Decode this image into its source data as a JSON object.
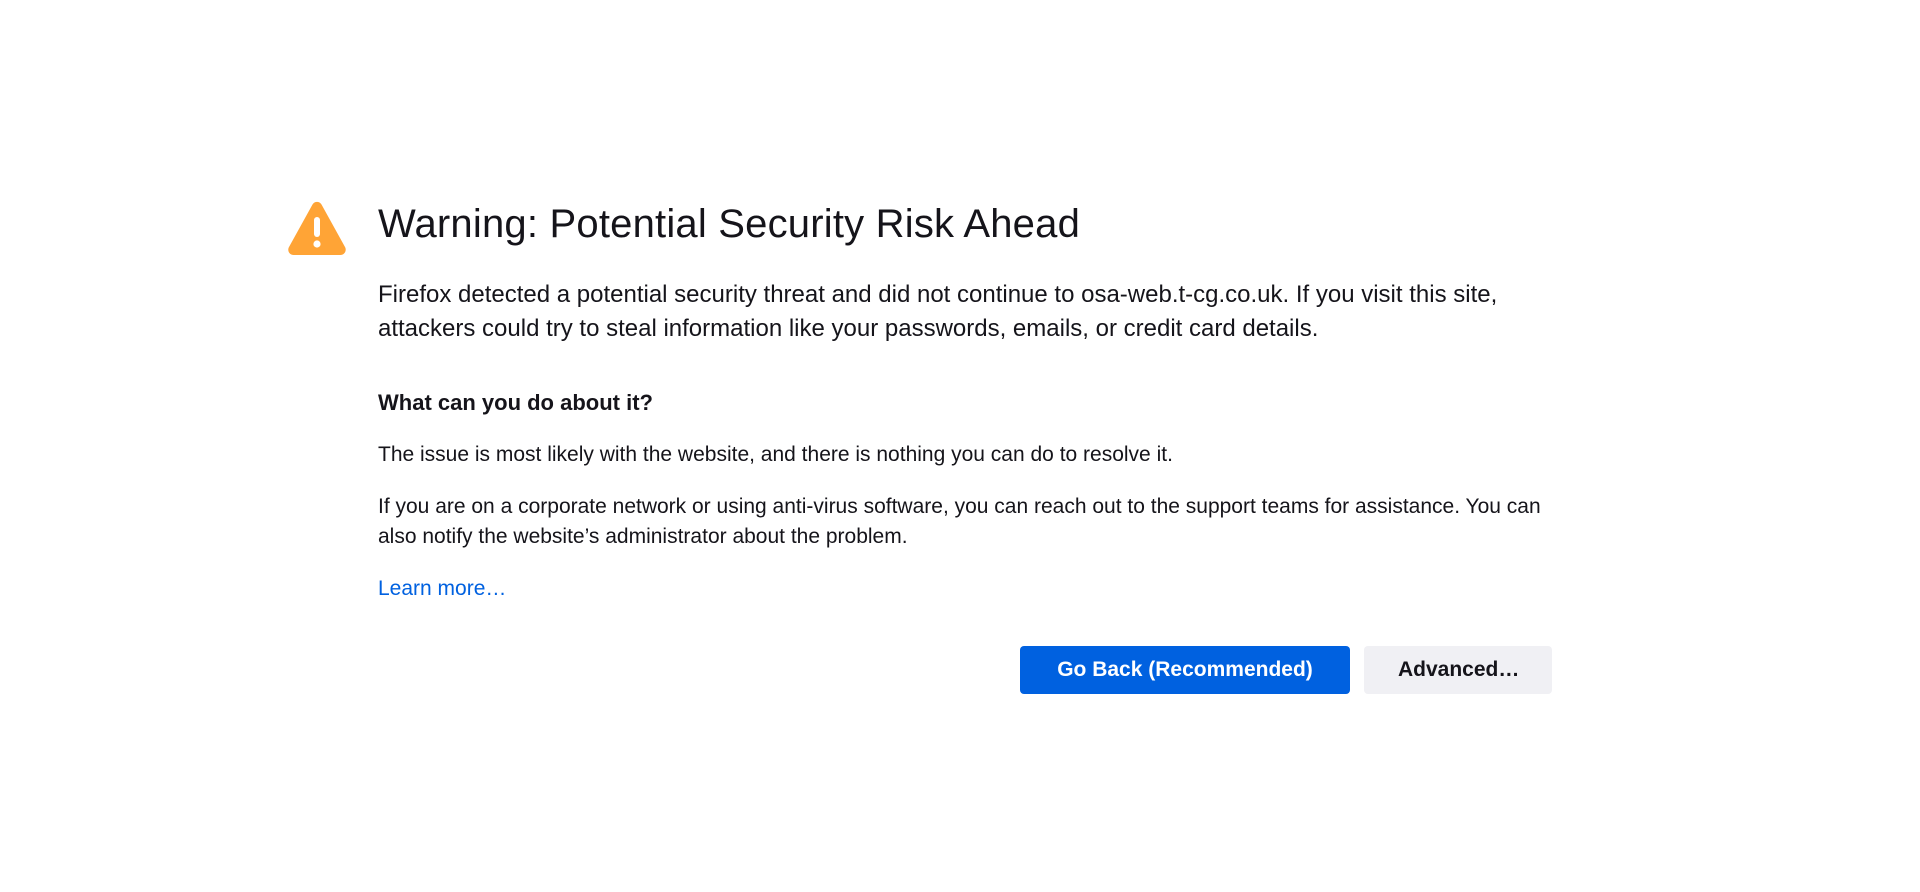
{
  "header": {
    "title": "Warning: Potential Security Risk Ahead"
  },
  "main": {
    "intro": "Firefox detected a potential security threat and did not continue to osa-web.t-cg.co.uk. If you visit this site, attackers could try to steal information like your passwords, emails, or credit card details.",
    "subheading": "What can you do about it?",
    "paragraphs": [
      "The issue is most likely with the website, and there is nothing you can do to resolve it.",
      "If you are on a corporate network or using anti-virus software, you can reach out to the support teams for assistance. You can also notify the website’s administrator about the problem."
    ],
    "learn_more": "Learn more…"
  },
  "buttons": {
    "go_back": "Go Back (Recommended)",
    "advanced": "Advanced…"
  },
  "icons": {
    "warning": "warning-icon"
  },
  "colors": {
    "warning": "#ffa436",
    "primary": "#0061e0",
    "link": "#0061e0",
    "secondary_bg": "#f0f0f4"
  }
}
